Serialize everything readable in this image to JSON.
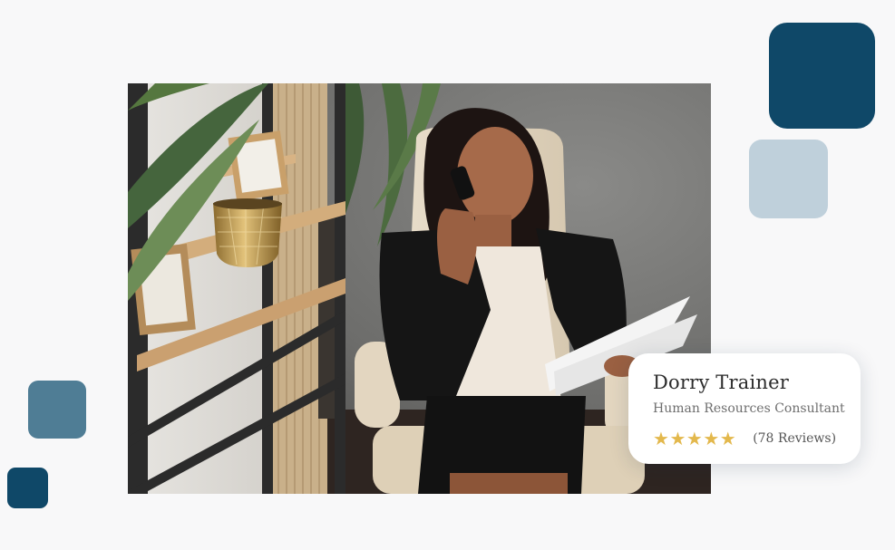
{
  "decor_colors": {
    "square_large": "#0f4868",
    "square_pale": "#bfd0db",
    "square_mid": "#4f7d95",
    "square_small": "#0f4868"
  },
  "photo": {
    "subject": "woman-on-phone-reading-document"
  },
  "profile_card": {
    "name": "Dorry Trainer",
    "role": "Human Resources Consultant",
    "rating": 5,
    "rating_max": 5,
    "star_glyph": "★",
    "reviews": "(78 Reviews)",
    "star_color": "#e3b84c"
  }
}
